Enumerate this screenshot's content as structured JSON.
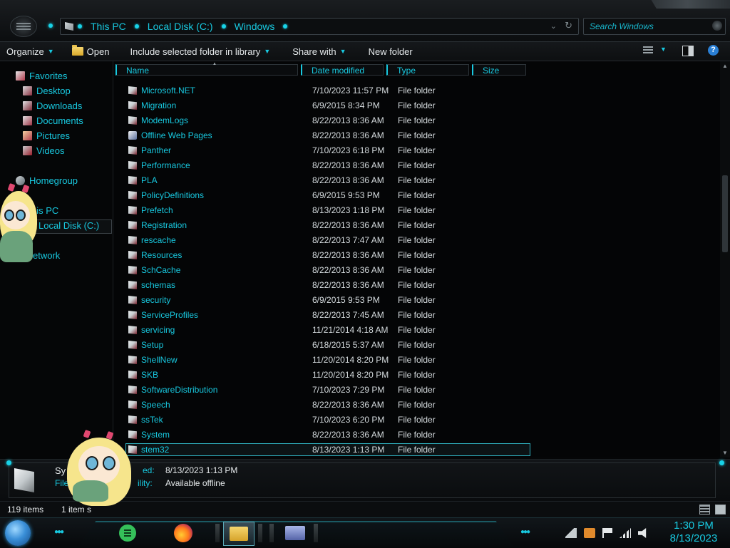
{
  "window": {
    "breadcrumbs": [
      "This PC",
      "Local Disk (C:)",
      "Windows"
    ],
    "search_placeholder": "Search Windows"
  },
  "toolbar": {
    "organize": "Organize",
    "open": "Open",
    "include": "Include selected folder in library",
    "share": "Share with",
    "new_folder": "New folder",
    "help": "?"
  },
  "nav": {
    "favorites": "Favorites",
    "desktop": "Desktop",
    "downloads": "Downloads",
    "documents": "Documents",
    "pictures": "Pictures",
    "videos": "Videos",
    "homegroup": "Homegroup",
    "this_pc": "his PC",
    "local_disk": "Local Disk (C:)",
    "network": "etwork"
  },
  "columns": {
    "name": "Name",
    "date": "Date modified",
    "type": "Type",
    "size": "Size"
  },
  "files": [
    {
      "name": "Microsoft.NET",
      "date": "7/10/2023 11:57 PM",
      "type": "File folder"
    },
    {
      "name": "Migration",
      "date": "6/9/2015 8:34 PM",
      "type": "File folder"
    },
    {
      "name": "ModemLogs",
      "date": "8/22/2013 8:36 AM",
      "type": "File folder"
    },
    {
      "name": "Offline Web Pages",
      "date": "8/22/2013 8:36 AM",
      "type": "File folder",
      "icon": "web"
    },
    {
      "name": "Panther",
      "date": "7/10/2023 6:18 PM",
      "type": "File folder"
    },
    {
      "name": "Performance",
      "date": "8/22/2013 8:36 AM",
      "type": "File folder"
    },
    {
      "name": "PLA",
      "date": "8/22/2013 8:36 AM",
      "type": "File folder"
    },
    {
      "name": "PolicyDefinitions",
      "date": "6/9/2015 9:53 PM",
      "type": "File folder"
    },
    {
      "name": "Prefetch",
      "date": "8/13/2023 1:18 PM",
      "type": "File folder"
    },
    {
      "name": "Registration",
      "date": "8/22/2013 8:36 AM",
      "type": "File folder"
    },
    {
      "name": "rescache",
      "date": "8/22/2013 7:47 AM",
      "type": "File folder"
    },
    {
      "name": "Resources",
      "date": "8/22/2013 8:36 AM",
      "type": "File folder"
    },
    {
      "name": "SchCache",
      "date": "8/22/2013 8:36 AM",
      "type": "File folder"
    },
    {
      "name": "schemas",
      "date": "8/22/2013 8:36 AM",
      "type": "File folder"
    },
    {
      "name": "security",
      "date": "6/9/2015 9:53 PM",
      "type": "File folder"
    },
    {
      "name": "ServiceProfiles",
      "date": "8/22/2013 7:45 AM",
      "type": "File folder"
    },
    {
      "name": "servicing",
      "date": "11/21/2014 4:18 AM",
      "type": "File folder"
    },
    {
      "name": "Setup",
      "date": "6/18/2015 5:37 AM",
      "type": "File folder"
    },
    {
      "name": "ShellNew",
      "date": "11/20/2014 8:20 PM",
      "type": "File folder"
    },
    {
      "name": "SKB",
      "date": "11/20/2014 8:20 PM",
      "type": "File folder"
    },
    {
      "name": "SoftwareDistribution",
      "date": "7/10/2023 7:29 PM",
      "type": "File folder"
    },
    {
      "name": "Speech",
      "date": "8/22/2013 8:36 AM",
      "type": "File folder"
    },
    {
      "name": "ssTek",
      "date": "7/10/2023 6:20 PM",
      "type": "File folder"
    },
    {
      "name": "System",
      "date": "8/22/2013 8:36 AM",
      "type": "File folder"
    },
    {
      "name": "stem32",
      "date": "8/13/2023 1:13 PM",
      "type": "File folder",
      "selected": true
    }
  ],
  "details": {
    "name_partial": "Sy",
    "type_partial": "File",
    "modified_label": "ed:",
    "modified_value": "8/13/2023 1:13 PM",
    "availability_label": "ility:",
    "availability_value": "Available offline"
  },
  "status": {
    "count": "119 items",
    "selected": "1 item s"
  },
  "clock": {
    "time": "1:30 PM",
    "date": "8/13/2023"
  },
  "colors": {
    "accent": "#18c9e0",
    "background": "#050607"
  }
}
